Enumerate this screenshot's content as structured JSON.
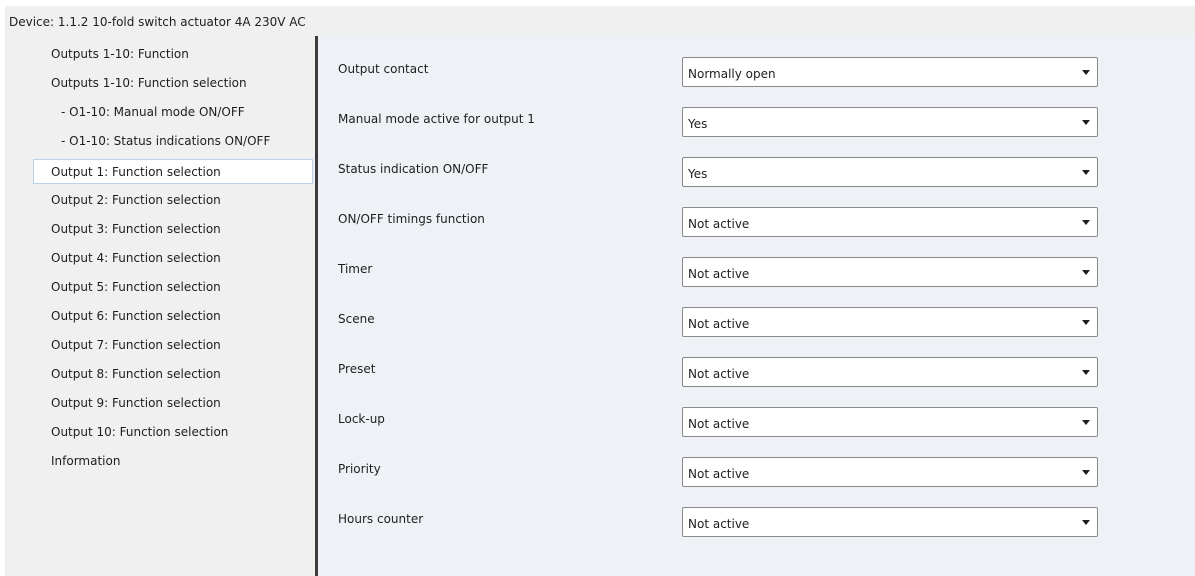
{
  "window": {
    "title": "Device: 1.1.2  10-fold switch actuator 4A 230V AC"
  },
  "sidebar": {
    "items": [
      {
        "label": "Outputs 1-10: Function"
      },
      {
        "label": "Outputs 1-10: Function selection"
      },
      {
        "label": "- O1-10: Manual mode ON/OFF"
      },
      {
        "label": "- O1-10: Status indications ON/OFF"
      },
      {
        "label": "Output 1: Function selection",
        "selected": true
      },
      {
        "label": "Output 2: Function selection"
      },
      {
        "label": "Output 3: Function selection"
      },
      {
        "label": "Output 4: Function selection"
      },
      {
        "label": "Output 5: Function selection"
      },
      {
        "label": "Output 6: Function selection"
      },
      {
        "label": "Output 7: Function selection"
      },
      {
        "label": "Output 8: Function selection"
      },
      {
        "label": "Output 9: Function selection"
      },
      {
        "label": "Output 10: Function selection"
      },
      {
        "label": "Information"
      }
    ]
  },
  "parameters": [
    {
      "label": "Output contact",
      "value": "Normally open"
    },
    {
      "label": "Manual mode active for output 1",
      "value": "Yes"
    },
    {
      "label": "Status indication ON/OFF",
      "value": "Yes"
    },
    {
      "label": "ON/OFF timings function",
      "value": "Not active"
    },
    {
      "label": "Timer",
      "value": "Not active"
    },
    {
      "label": "Scene",
      "value": "Not active"
    },
    {
      "label": "Preset",
      "value": "Not active"
    },
    {
      "label": "Lock-up",
      "value": "Not active"
    },
    {
      "label": "Priority",
      "value": "Not active"
    },
    {
      "label": "Hours counter",
      "value": "Not active"
    }
  ],
  "icons": {
    "dropdown_arrow": "chevron-down-icon"
  },
  "colors": {
    "sidebar_bg": "#f0f0f0",
    "main_bg": "#eef2f6",
    "selected_border": "#b9d1ea",
    "splitter": "#3c3c3c"
  }
}
